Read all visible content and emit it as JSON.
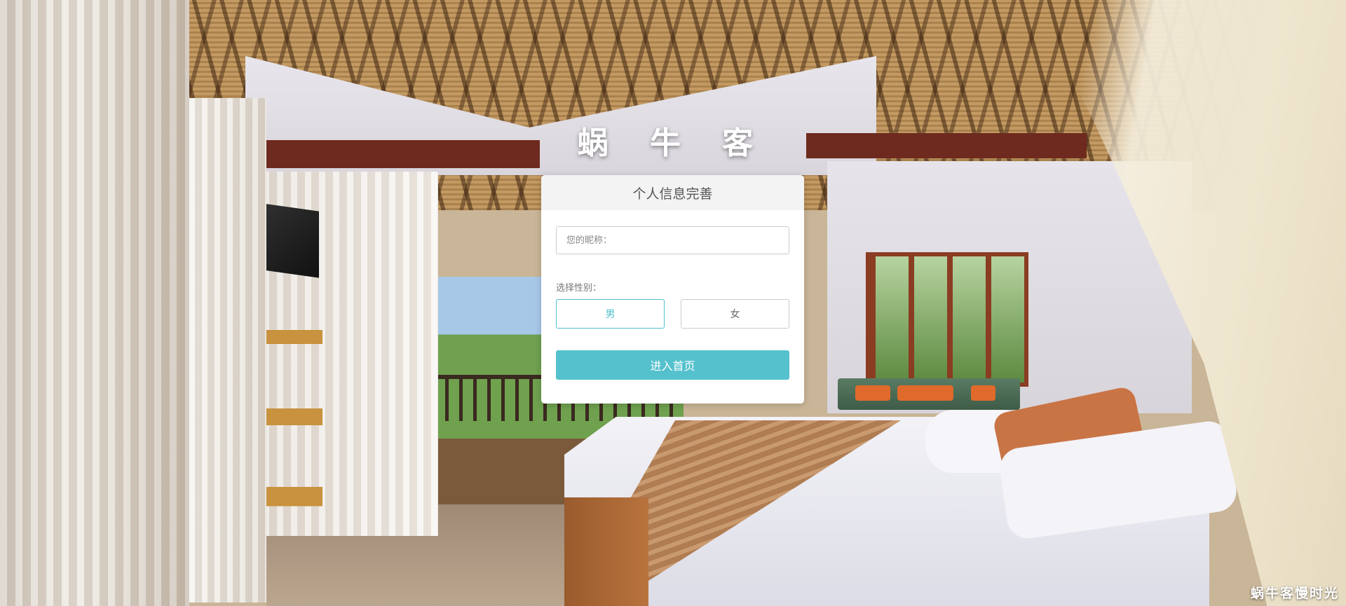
{
  "brand": {
    "title": "蜗 牛 客"
  },
  "form": {
    "header_title": "个人信息完善",
    "nickname_placeholder": "您的昵称：",
    "nickname_value": "",
    "gender_label": "选择性别：",
    "gender_options": [
      "男",
      "女"
    ],
    "gender_selected": "男",
    "submit_label": "进入首页"
  },
  "watermark": {
    "text": "蜗牛客慢时光"
  },
  "colors": {
    "accent": "#54c1cd",
    "selected_border": "#4fc0cd",
    "header_bg": "#f3f3f3",
    "card_bg": "#ffffff"
  }
}
